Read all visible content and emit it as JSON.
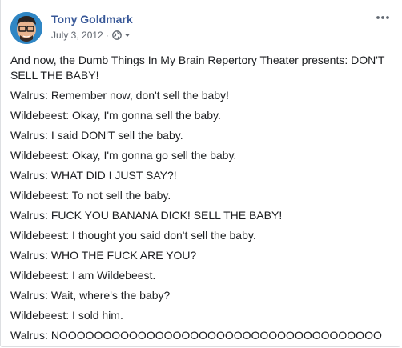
{
  "post": {
    "author": "Tony Goldmark",
    "date": "July 3, 2012",
    "separator": "·",
    "privacy_icon": "globe-icon",
    "privacy_dropdown_icon": "caret-down-icon",
    "options_icon": "more-horizontal-icon",
    "colors": {
      "author_link": "#385898",
      "meta_text": "#616770",
      "body_text": "#1c1e21",
      "border": "#dddfe2"
    },
    "lines": [
      "And now, the Dumb Things In My Brain Repertory Theater presents: DON'T SELL THE BABY!",
      "Walrus: Remember now, don't sell the baby!",
      "Wildebeest: Okay, I'm gonna sell the baby.",
      "Walrus: I said DON'T sell the baby.",
      "Wildebeest: Okay, I'm gonna go sell the baby.",
      "Walrus: WHAT DID I JUST SAY?!",
      "Wildebeest: To not sell the baby.",
      "Walrus: FUCK YOU BANANA DICK! SELL THE BABY!",
      "Wildebeest: I thought you said don't sell the baby.",
      "Walrus: WHO THE FUCK ARE YOU?",
      "Wildebeest: I am Wildebeest.",
      "Walrus: Wait, where's the baby?",
      "Wildebeest: I sold him.",
      "Walrus: NOOOOOOOOOOOOOOOOOOOOOOOOOOOOOOOOOOOOO"
    ]
  }
}
